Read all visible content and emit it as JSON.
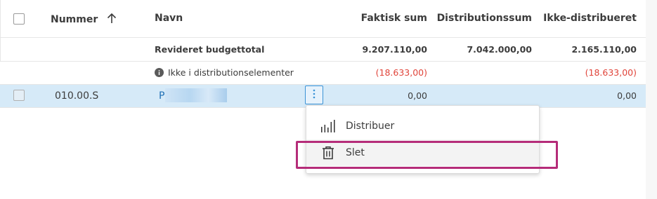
{
  "table": {
    "columns": {
      "number": "Nummer",
      "name": "Navn",
      "actual_sum": "Faktisk sum",
      "distribution_sum": "Distributionssum",
      "undistributed": "Ikke-distribueret"
    },
    "rows": [
      {
        "label": "Revideret budgettotal",
        "actual_sum": "9.207.110,00",
        "distribution_sum": "7.042.000,00",
        "undistributed": "2.165.110,00"
      },
      {
        "label": "Ikke i distributionselementer",
        "actual_sum": "(18.633,00)",
        "distribution_sum": "",
        "undistributed": "(18.633,00)"
      },
      {
        "number": "010.00.S",
        "name_prefix": "P",
        "actual_sum": "0,00",
        "distribution_sum": "",
        "undistributed": "0,00"
      }
    ]
  },
  "context_menu": {
    "items": [
      {
        "label": "Distribuer",
        "icon": "bar-chart-icon"
      },
      {
        "label": "Slet",
        "icon": "trash-icon"
      }
    ]
  },
  "colors": {
    "selected_row": "#d6eaf8",
    "negative": "#e0443a",
    "highlight": "#b52c79",
    "accent": "#3b93d6"
  }
}
